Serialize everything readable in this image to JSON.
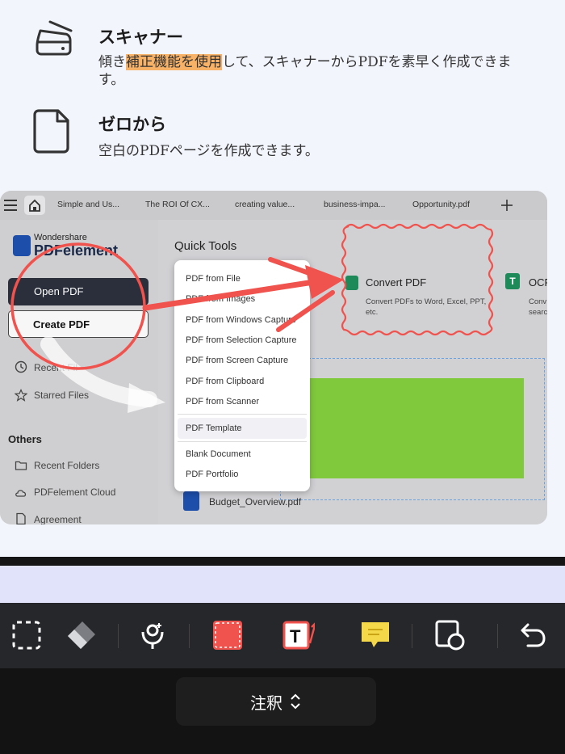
{
  "features": [
    {
      "title": "スキャナー",
      "desc_pre": "傾き",
      "desc_highlight": "補正機能を使用",
      "desc_post": "して、スキャナーからPDFを素早く作成できます。",
      "icon": "scanner-icon"
    },
    {
      "title": "ゼロから",
      "desc": "空白のPDFページを作成できます。",
      "icon": "blank-page-icon"
    }
  ],
  "screenshot": {
    "tabs": [
      "Simple and Us...",
      "The ROI Of CX...",
      "creating value...",
      "business-impa...",
      "Opportunity.pdf"
    ],
    "logo_top": "Wondershare",
    "logo_main": "PDFelement",
    "open_pdf": "Open PDF",
    "create_pdf": "Create PDF",
    "recent_files": "Recent Fil",
    "starred_files": "Starred Files",
    "others": "Others",
    "recent_folders": "Recent Folders",
    "cloud": "PDFelement Cloud",
    "agreement": "Agreement",
    "quick_tools": "Quick Tools",
    "menu_items": [
      "PDF from File",
      "PDF from Images",
      "PDF from Windows Capture",
      "PDF from Selection Capture",
      "PDF from Screen Capture",
      "PDF from Clipboard",
      "PDF from Scanner",
      "PDF Template",
      "Blank Document",
      "PDF Portfolio"
    ],
    "convert_title": "Convert PDF",
    "convert_desc": "Convert PDFs to Word, Excel, PPT, etc.",
    "ocr_title": "OCF",
    "ocr_desc_1": "Conv",
    "ocr_desc_2": "searc",
    "ocr_icon_letter": "T",
    "budget_file": "Budget_Overview.pdf"
  },
  "toolbar": {
    "tools": [
      "select-area-icon",
      "eraser-icon",
      "microphone-icon",
      "rectangle-icon",
      "text-box-icon",
      "sticky-note-icon",
      "shape-icon",
      "undo-icon"
    ],
    "text_tool_letter": "T"
  },
  "mode": {
    "label": "注釈"
  },
  "colors": {
    "highlight": "#f7b267",
    "annotation_red": "#f0524d",
    "note_yellow": "#f5d84a",
    "green_fill": "#80c93c"
  }
}
